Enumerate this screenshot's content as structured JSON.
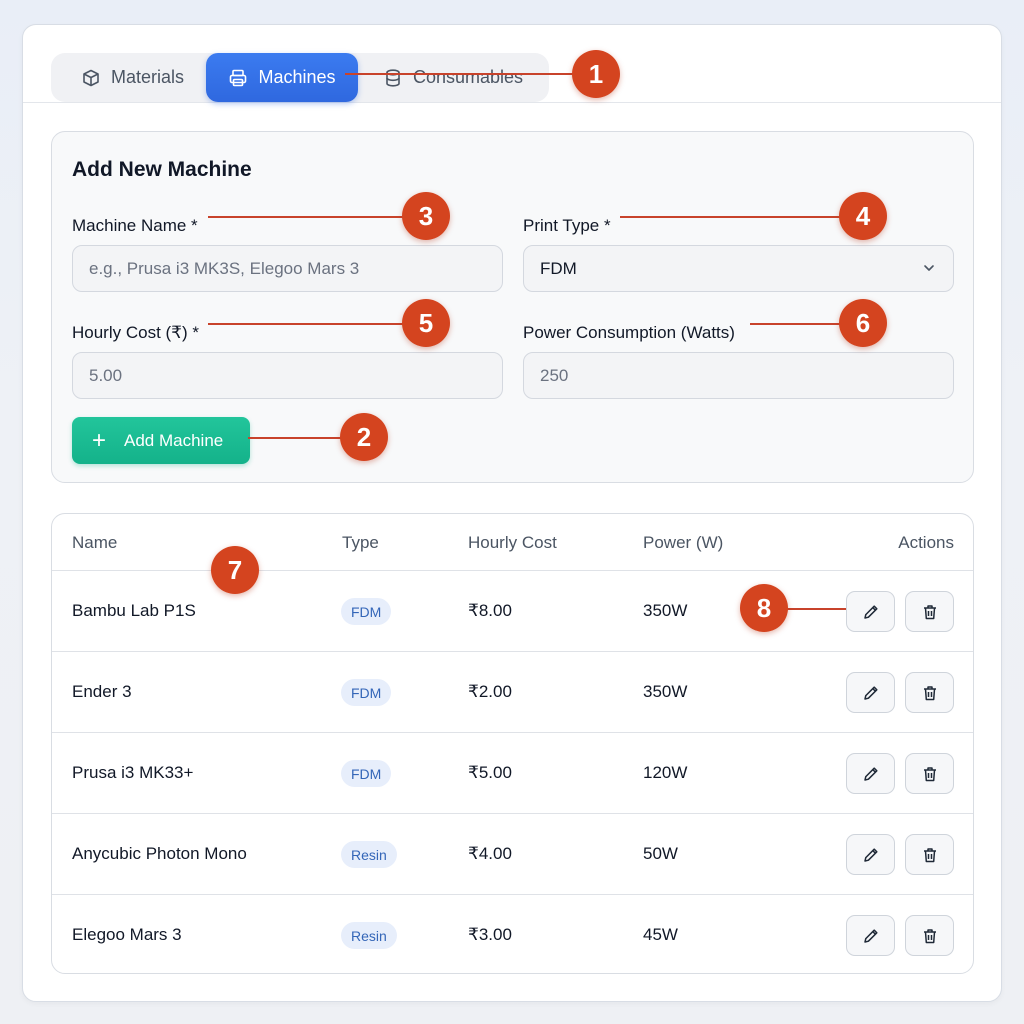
{
  "tabs": [
    {
      "label": "Materials",
      "icon": "box-icon"
    },
    {
      "label": "Machines",
      "icon": "printer-icon",
      "active": true
    },
    {
      "label": "Consumables",
      "icon": "database-icon"
    }
  ],
  "form": {
    "title": "Add New Machine",
    "machine_name_label": "Machine Name *",
    "machine_name_placeholder": "e.g., Prusa i3 MK3S, Elegoo Mars 3",
    "print_type_label": "Print Type *",
    "print_type_value": "FDM",
    "hourly_cost_label": "Hourly Cost (₹) *",
    "hourly_cost_placeholder": "5.00",
    "power_label": "Power Consumption (Watts)",
    "power_placeholder": "250",
    "add_button_label": "Add Machine"
  },
  "table": {
    "headers": [
      "Name",
      "Type",
      "Hourly Cost",
      "Power (W)",
      "Actions"
    ],
    "rows": [
      {
        "name": "Bambu Lab P1S",
        "type": "FDM",
        "cost": "₹8.00",
        "power": "350W"
      },
      {
        "name": "Ender 3",
        "type": "FDM",
        "cost": "₹2.00",
        "power": "350W"
      },
      {
        "name": "Prusa i3 MK33+",
        "type": "FDM",
        "cost": "₹5.00",
        "power": "120W"
      },
      {
        "name": "Anycubic Photon Mono",
        "type": "Resin",
        "cost": "₹4.00",
        "power": "50W"
      },
      {
        "name": "Elegoo Mars 3",
        "type": "Resin",
        "cost": "₹3.00",
        "power": "45W"
      }
    ]
  },
  "callouts": [
    "1",
    "2",
    "3",
    "4",
    "5",
    "6",
    "7",
    "8"
  ],
  "colors": {
    "accent": "#2f68df",
    "success": "#14b28a",
    "callout": "#d4441f"
  }
}
